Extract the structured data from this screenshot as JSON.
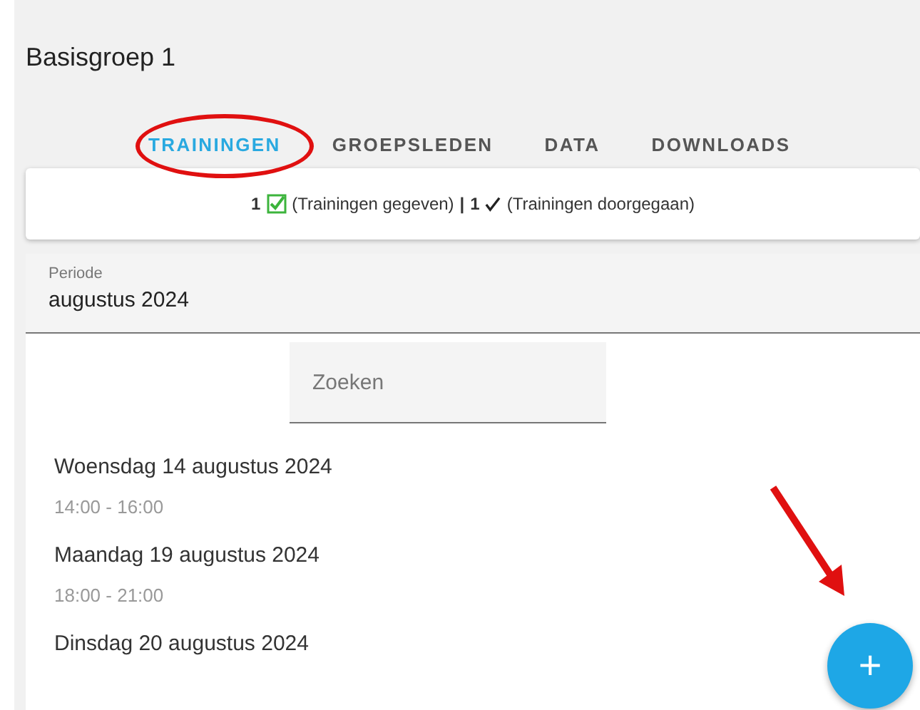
{
  "title": "Basisgroep 1",
  "tabs": [
    {
      "label": "TRAININGEN",
      "selected": true
    },
    {
      "label": "GROEPSLEDEN",
      "selected": false
    },
    {
      "label": "DATA",
      "selected": false
    },
    {
      "label": "DOWNLOADS",
      "selected": false
    }
  ],
  "summary": {
    "given_count": "1",
    "given_label": "(Trainingen gegeven)",
    "separator": "|",
    "done_count": "1",
    "done_label": "(Trainingen doorgegaan)"
  },
  "period": {
    "label": "Periode",
    "value": "augustus 2024"
  },
  "search": {
    "placeholder": "Zoeken"
  },
  "trainings": [
    {
      "date": "Woensdag 14 augustus 2024",
      "time": "14:00 - 16:00"
    },
    {
      "date": "Maandag 19 augustus 2024",
      "time": "18:00 - 21:00"
    },
    {
      "date": "Dinsdag 20 augustus 2024"
    }
  ],
  "fab": {
    "label": "+"
  }
}
